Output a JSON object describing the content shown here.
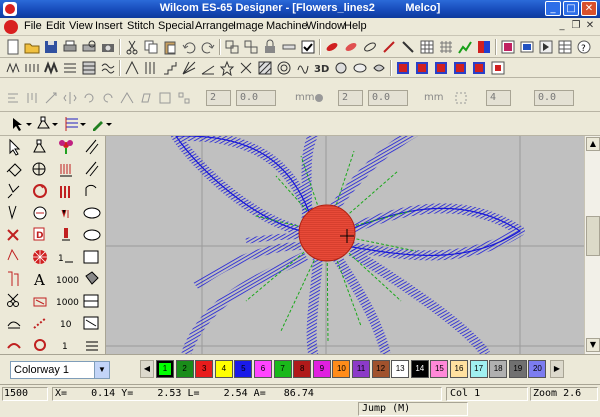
{
  "window": {
    "title": "Wilcom ES-65 Designer - [Flowers_lines2          Melco]",
    "min_label": "_",
    "max_label": "□",
    "close_label": "✕"
  },
  "menu": {
    "items": [
      "File",
      "Edit",
      "View",
      "Insert",
      "Stitch",
      "Special",
      "Arrange",
      "Image",
      "Machine",
      "Window",
      "Help"
    ],
    "mdi_minimize": "_",
    "mdi_restore": "❐",
    "mdi_close": "✕"
  },
  "property_bar": {
    "fields": [
      "2",
      "0.0",
      "2",
      "0.0",
      "4",
      "0.0"
    ],
    "unit": "mm"
  },
  "colors": {
    "accent": "#1649b8",
    "thread_blue": "#1a1ad8",
    "thread_red": "#e03a2a",
    "thread_green": "#1aa81a",
    "canvas_bg": "#c0c0c0"
  },
  "colorway": {
    "selected": "Colorway 1"
  },
  "palette": {
    "swatches": [
      {
        "label": "1",
        "color": "#00ff00"
      },
      {
        "label": "2",
        "color": "#1a8c1a"
      },
      {
        "label": "3",
        "color": "#e81c1c"
      },
      {
        "label": "4",
        "color": "#ffff00"
      },
      {
        "label": "5",
        "color": "#1a1ae8"
      },
      {
        "label": "6",
        "color": "#ff44ff"
      },
      {
        "label": "7",
        "color": "#1ab81a"
      },
      {
        "label": "8",
        "color": "#b01a1a"
      },
      {
        "label": "9",
        "color": "#e020e0"
      },
      {
        "label": "10",
        "color": "#ff8c1a"
      },
      {
        "label": "11",
        "color": "#8c3ac8"
      },
      {
        "label": "12",
        "color": "#a0522d"
      },
      {
        "label": "13",
        "color": "#ffffff"
      },
      {
        "label": "14",
        "color": "#000000"
      },
      {
        "label": "15",
        "color": "#ff88d8"
      },
      {
        "label": "16",
        "color": "#ffe0a0"
      },
      {
        "label": "17",
        "color": "#a0f0f0"
      },
      {
        "label": "18",
        "color": "#b0b0b0"
      },
      {
        "label": "19",
        "color": "#707070"
      },
      {
        "label": "20",
        "color": "#7c7cf0"
      }
    ]
  },
  "status": {
    "stitch_count": "1500",
    "coords": "X=    0.14 Y=    2.53 L=    2.54 A=   86.74",
    "color": "Col 1",
    "zoom": "Zoom 2.6",
    "mode": "Jump (M)"
  },
  "icons": {
    "left_toolbox": [
      "select-icon",
      "reshape-icon",
      "flower-icon",
      "line-icon",
      "open-object-icon",
      "digitize-icon",
      "stitch-icon",
      "arc-icon",
      "reverse-icon",
      "rotate-icon",
      "satin-icon",
      "curve-icon",
      "trim-icon",
      "fill-icon",
      "column-icon",
      "oval-icon",
      "vector-icon",
      "net-fill-icon",
      "motif-icon",
      "rectangle-icon",
      "pattern-icon",
      "lettering-icon",
      "number-icon",
      "bucket-icon",
      "scissors-icon",
      "mirror-icon",
      "grid-icon",
      "scale-icon",
      "stamp-icon",
      "chain-icon",
      "sequence-icon",
      "brush-icon",
      "arc2-icon",
      "ring-icon",
      "bottom-icon",
      "bottom2-icon"
    ]
  }
}
